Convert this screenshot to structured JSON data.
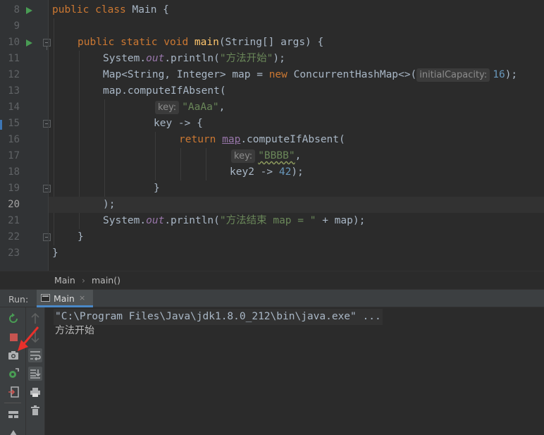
{
  "editor": {
    "line_numbers": [
      "8",
      "9",
      "10",
      "11",
      "12",
      "13",
      "14",
      "15",
      "16",
      "17",
      "18",
      "19",
      "20",
      "21",
      "22",
      "23"
    ],
    "code": {
      "l8": {
        "kw1": "public",
        "kw2": "class",
        "name": "Main",
        "brace": "{"
      },
      "l10": {
        "kw1": "public",
        "kw2": "static",
        "kw3": "void",
        "fn": "main",
        "rest": "(String[] args) {"
      },
      "l11": {
        "obj": "System.",
        "field": "out",
        "call": ".println(",
        "str": "\"方法开始\"",
        "end": ");"
      },
      "l12": {
        "decl": "Map<String, Integer> map = ",
        "kw": "new",
        "ctor": " ConcurrentHashMap<>(",
        "hint": "initialCapacity:",
        "num": "16",
        "end": ");"
      },
      "l13": {
        "text": "map.computeIfAbsent("
      },
      "l14": {
        "hint": "key:",
        "str": "\"AaAa\"",
        "end": ","
      },
      "l15": {
        "text": "key -> {"
      },
      "l16": {
        "kw": "return",
        "map": "map",
        "call": ".computeIfAbsent("
      },
      "l17": {
        "hint": "key:",
        "str": "\"BBBB\"",
        "end": ","
      },
      "l18": {
        "text": "key2 -> ",
        "num": "42",
        "end": ");"
      },
      "l19": {
        "text": "}"
      },
      "l20": {
        "text": ");"
      },
      "l21": {
        "obj": "System.",
        "field": "out",
        "call": ".println(",
        "str": "\"方法结束 map = \"",
        "end": " + map);"
      },
      "l22": {
        "text": "}"
      },
      "l23": {
        "text": "}"
      }
    }
  },
  "breadcrumb": {
    "class": "Main",
    "separator": "›",
    "method": "main()"
  },
  "run": {
    "label": "Run:",
    "tab": {
      "label": "Main",
      "close": "×"
    },
    "console": {
      "command": "\"C:\\Program Files\\Java\\jdk1.8.0_212\\bin\\java.exe\" ...",
      "output": "方法开始"
    }
  },
  "colors": {
    "keyword": "#cc7832",
    "string": "#6a8759",
    "number": "#6897bb",
    "function": "#ffc66d",
    "field": "#9876aa",
    "run_green": "#499c54",
    "stop_red": "#c75450",
    "annotation_arrow": "#e8302b"
  }
}
